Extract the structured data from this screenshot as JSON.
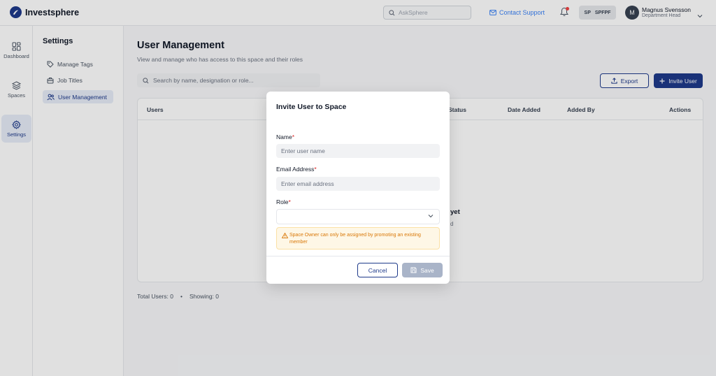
{
  "brand": {
    "name": "Investsphere"
  },
  "header": {
    "search_placeholder": "AskSphere",
    "contact_support": "Contact Support",
    "space_chip": {
      "code": "SP",
      "name": "SPFPF"
    },
    "user": {
      "initial": "M",
      "name": "Magnus Svensson",
      "role": "Department Head"
    }
  },
  "rail": {
    "items": [
      {
        "label": "Dashboard",
        "icon": "grid-icon"
      },
      {
        "label": "Spaces",
        "icon": "layers-icon"
      },
      {
        "label": "Settings",
        "icon": "gear-icon",
        "active": true
      }
    ]
  },
  "settings": {
    "title": "Settings",
    "items": [
      {
        "label": "Manage Tags",
        "icon": "tag-icon"
      },
      {
        "label": "Job Titles",
        "icon": "briefcase-icon"
      },
      {
        "label": "User Management",
        "icon": "users-icon",
        "active": true
      }
    ]
  },
  "main": {
    "title": "User Management",
    "subtitle": "View and manage  who has access to this space and their roles",
    "search_placeholder": "Search by name, designation or role...",
    "export_label": "Export",
    "invite_label": "Invite User",
    "columns": [
      "Users",
      "Status",
      "Date Added",
      "Added By",
      "Actions"
    ],
    "empty_title_fragment": "yet",
    "empty_sub_fragment": "d",
    "total_users": "Total Users: 0",
    "separator": "•",
    "showing": "Showing: 0"
  },
  "modal": {
    "title": "Invite User to Space",
    "name_label": "Name",
    "name_placeholder": "Enter user name",
    "email_label": "Email Address",
    "email_placeholder": "Enter email address",
    "role_label": "Role",
    "required_mark": "*",
    "warning": "Space Owner can only be assigned by promoting an existing member",
    "cancel_label": "Cancel",
    "save_label": "Save"
  },
  "colors": {
    "primary": "#1e3a8a",
    "link": "#3b82f6",
    "warning_text": "#d97706",
    "warning_bg": "#fef7e6",
    "disabled_button": "#a9b4c8",
    "required": "#dc2626"
  }
}
